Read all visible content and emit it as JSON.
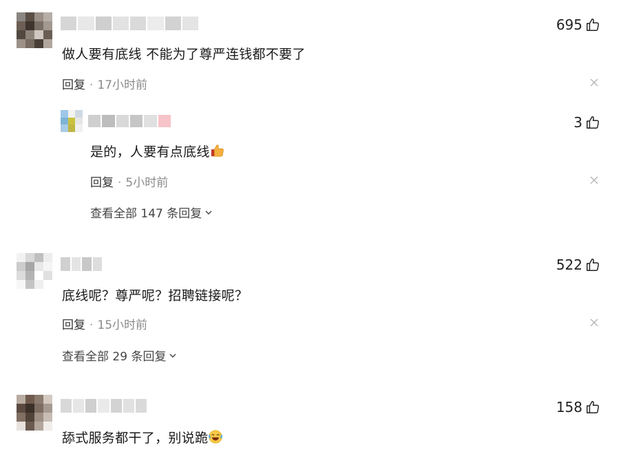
{
  "comments": [
    {
      "text": "做人要有底线 不能为了尊严连钱都不要了",
      "reply_label": "回复",
      "time": "17小时前",
      "likes": "695",
      "avatar_colors": [
        "#8a8580",
        "#5b4e45",
        "#9a8f86",
        "#b7aea7",
        "#6d5f55",
        "#3f342e",
        "#7b6e64",
        "#a39990",
        "#524840",
        "#8e8379",
        "#cfc7c0",
        "#6a5d53",
        "#9d9188",
        "#786b61",
        "#4a3f38",
        "#b1a69d"
      ],
      "name_colors": [
        "#d6d6d6",
        "#e8e8e8",
        "#cfcfcf",
        "#e2e2e2",
        "#dadada",
        "#ececec",
        "#d2d2d2",
        "#e4e4e4"
      ],
      "reply": {
        "text": "是的，人要有点底线",
        "emoji": "thumbs-up-emoji",
        "reply_label": "回复",
        "time": "5小时前",
        "likes": "3",
        "avatar_colors": [
          "#9ec7e8",
          "#f3f3f3",
          "#cfd9e2",
          "#7fb3d6",
          "#c9c23e",
          "#e6e6e6",
          "#a8cbe6",
          "#bfb643",
          "#f0f0f0"
        ],
        "name_colors": [
          "#cfcfcf",
          "#bdbdbd",
          "#d9d9d9",
          "#c6c6c6",
          "#e0e0e0",
          "#f6c3c8"
        ],
        "view_all": "查看全部 147 条回复"
      }
    },
    {
      "text": "底线呢？尊严呢？招聘链接呢？",
      "reply_label": "回复",
      "time": "15小时前",
      "likes": "522",
      "avatar_colors": [
        "#f2f2f2",
        "#d9d9d9",
        "#bfbfbf",
        "#ededed",
        "#cccccc",
        "#a6a6a6",
        "#e8e8e8",
        "#f5f5f5",
        "#dcdcdc",
        "#b3b3b3",
        "#ffffff",
        "#e0e0e0",
        "#f7f7f7",
        "#c4c4c4",
        "#efefef",
        "#ffffff"
      ],
      "name_colors": [
        "#d0d0d0",
        "#e4e4e4",
        "#c8c8c8",
        "#dddddd"
      ],
      "view_all": "查看全部 29 条回复"
    },
    {
      "text": "舔式服务都干了，别说跪",
      "emoji": "crying-laughing-emoji",
      "likes": "158",
      "avatar_colors": [
        "#b8aca3",
        "#6f5a4d",
        "#8c7b6f",
        "#d3c9c1",
        "#5a4a40",
        "#3c3029",
        "#7d6c61",
        "#a69a90",
        "#816f63",
        "#524339",
        "#9e8f84",
        "#c7bdb4",
        "#e8e2dd",
        "#6b5a4f",
        "#b2a69c",
        "#f1ede9"
      ],
      "name_colors": [
        "#d8d8d8",
        "#e6e6e6",
        "#cfcfcf",
        "#eaeaea",
        "#d3d3d3",
        "#e1e1e1",
        "#dadada"
      ]
    }
  ]
}
